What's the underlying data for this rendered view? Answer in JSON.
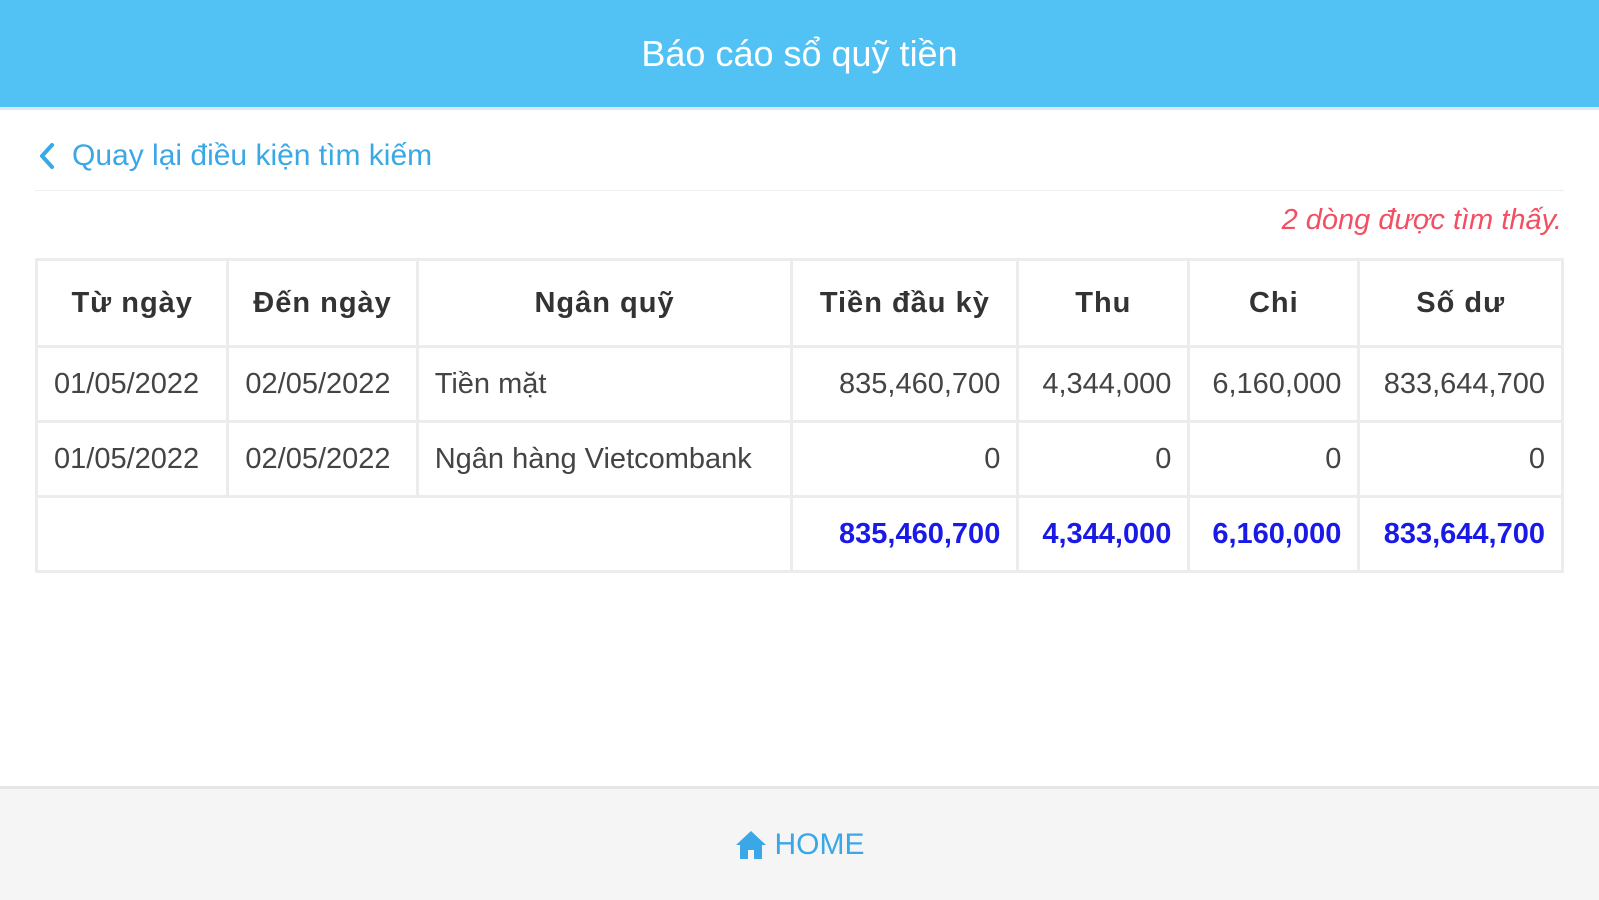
{
  "header": {
    "title": "Báo cáo sổ quỹ tiền"
  },
  "nav": {
    "back_label": "Quay lại điều kiện tìm kiếm",
    "back_icon": "chevron-left-icon"
  },
  "result": {
    "count_text": "2 dòng được tìm thấy."
  },
  "table": {
    "columns": [
      "Từ ngày",
      "Đến ngày",
      "Ngân quỹ",
      "Tiền đầu kỳ",
      "Thu",
      "Chi",
      "Số dư"
    ],
    "rows": [
      {
        "from": "01/05/2022",
        "to": "02/05/2022",
        "fund": "Tiền mặt",
        "opening": "835,460,700",
        "income": "4,344,000",
        "expense": "6,160,000",
        "balance": "833,644,700"
      },
      {
        "from": "01/05/2022",
        "to": "02/05/2022",
        "fund": "Ngân hàng Vietcombank",
        "opening": "0",
        "income": "0",
        "expense": "0",
        "balance": "0"
      }
    ],
    "totals": {
      "opening": "835,460,700",
      "income": "4,344,000",
      "expense": "6,160,000",
      "balance": "833,644,700"
    }
  },
  "footer": {
    "home_label": "HOME",
    "home_icon": "home-icon"
  },
  "colors": {
    "header": "#52c2f5",
    "link": "#3aa7e6",
    "count": "#f24f62",
    "total": "#1a1ae6"
  }
}
